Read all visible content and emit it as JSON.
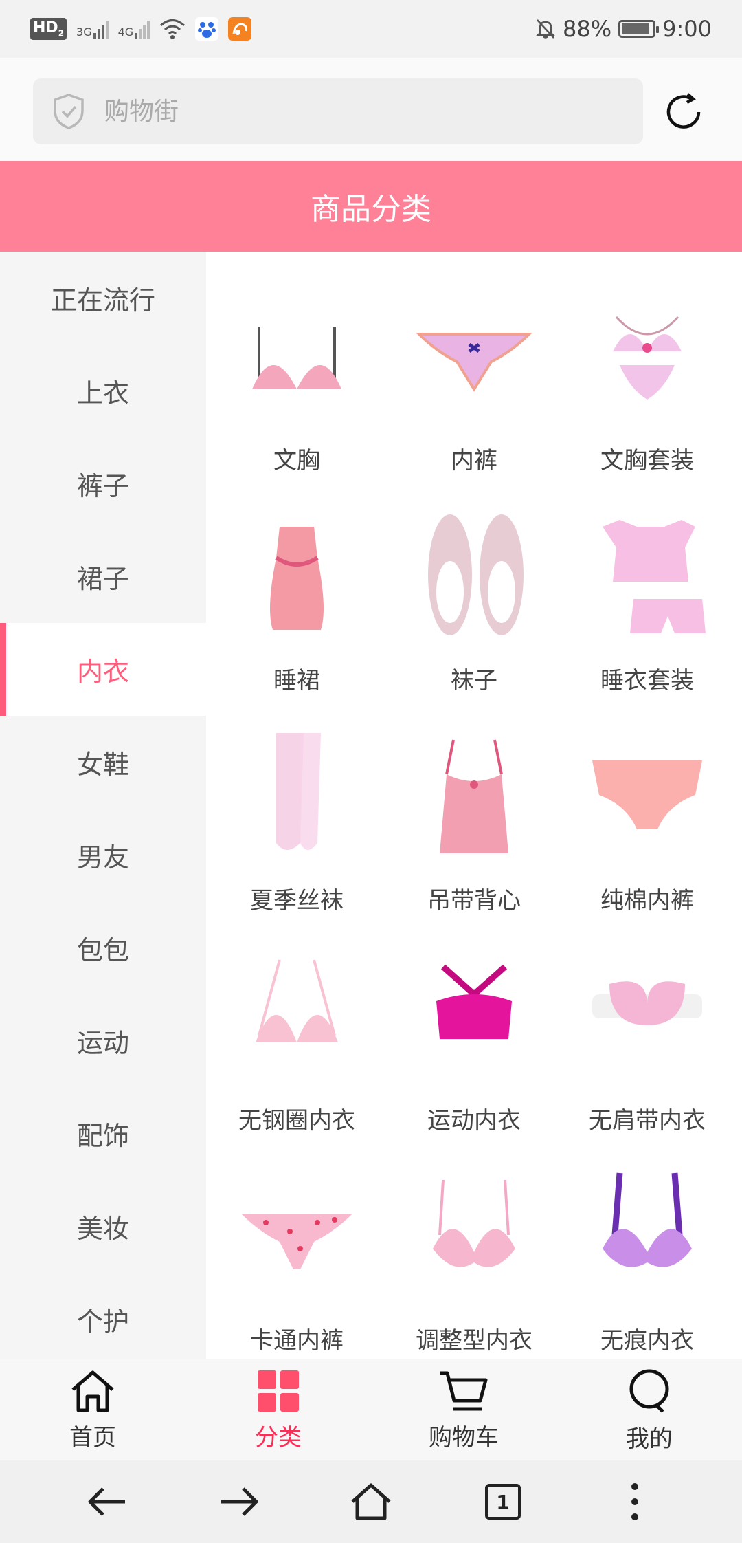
{
  "status_bar": {
    "hd": "HD",
    "sim2": "2",
    "net1": "3G",
    "net2": "4G",
    "battery": "88%",
    "time": "9:00",
    "battery_level": 0.88
  },
  "search": {
    "placeholder": "购物街"
  },
  "header": {
    "title": "商品分类"
  },
  "sidebar": {
    "items": [
      {
        "label": "正在流行"
      },
      {
        "label": "上衣"
      },
      {
        "label": "裤子"
      },
      {
        "label": "裙子"
      },
      {
        "label": "内衣",
        "active": true
      },
      {
        "label": "女鞋"
      },
      {
        "label": "男友"
      },
      {
        "label": "包包"
      },
      {
        "label": "运动"
      },
      {
        "label": "配饰"
      },
      {
        "label": "美妆"
      },
      {
        "label": "个护"
      }
    ]
  },
  "products": [
    {
      "label": "文胸",
      "icon": "bra-icon",
      "color": "#f4a6bd"
    },
    {
      "label": "内裤",
      "icon": "panties-icon",
      "color": "#e9b3e3"
    },
    {
      "label": "文胸套装",
      "icon": "bra-set-icon",
      "color": "#f3c4ea"
    },
    {
      "label": "睡裙",
      "icon": "nightgown-icon",
      "color": "#f49aa5"
    },
    {
      "label": "袜子",
      "icon": "socks-icon",
      "color": "#e8ccd4"
    },
    {
      "label": "睡衣套装",
      "icon": "pajama-set-icon",
      "color": "#f6bfe3"
    },
    {
      "label": "夏季丝袜",
      "icon": "stockings-icon",
      "color": "#f7d3e8"
    },
    {
      "label": "吊带背心",
      "icon": "camisole-icon",
      "color": "#f29fb1"
    },
    {
      "label": "纯棉内裤",
      "icon": "cotton-panties-icon",
      "color": "#fbb0ad"
    },
    {
      "label": "无钢圈内衣",
      "icon": "wireless-bra-icon",
      "color": "#f8c2d2"
    },
    {
      "label": "运动内衣",
      "icon": "sports-bra-icon",
      "color": "#e4149c"
    },
    {
      "label": "无肩带内衣",
      "icon": "strapless-bra-icon",
      "color": "#f4b6d4"
    },
    {
      "label": "卡通内裤",
      "icon": "cartoon-panties-icon",
      "color": "#f8b8cd"
    },
    {
      "label": "调整型内衣",
      "icon": "shaping-bra-icon",
      "color": "#f3a9c6"
    },
    {
      "label": "无痕内衣",
      "icon": "seamless-bra-icon",
      "color": "#c98fe8"
    }
  ],
  "tabbar": {
    "items": [
      {
        "label": "首页",
        "icon": "home-icon"
      },
      {
        "label": "分类",
        "icon": "category-icon",
        "active": true
      },
      {
        "label": "购物车",
        "icon": "cart-icon"
      },
      {
        "label": "我的",
        "icon": "profile-icon"
      }
    ]
  },
  "browser_nav": {
    "tab_count": "1"
  },
  "colors": {
    "accent": "#ff8197",
    "active_text": "#ff5c7c",
    "active_tab": "#ff2d55"
  }
}
